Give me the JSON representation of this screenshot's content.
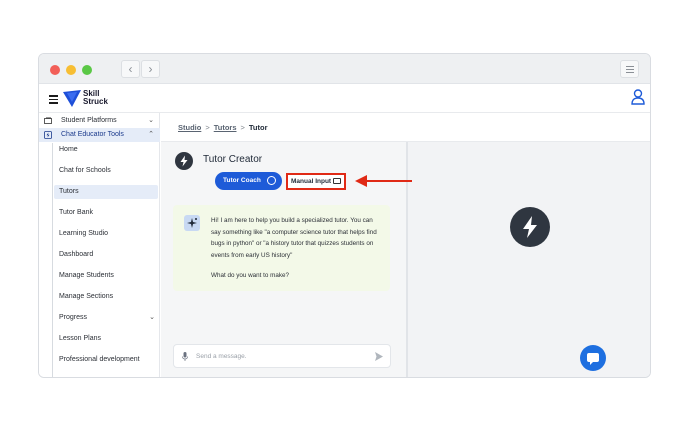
{
  "logo": {
    "line1": "Skill",
    "line2": "Struck"
  },
  "sidebar": {
    "top_items": [
      {
        "label": "Student Platforms",
        "icon": "platforms-icon"
      },
      {
        "label": "Chat Educator Tools",
        "icon": "educator-tools-icon"
      }
    ],
    "sub_items": [
      {
        "label": "Home"
      },
      {
        "label": "Chat for Schools"
      },
      {
        "label": "Tutors"
      },
      {
        "label": "Tutor Bank"
      },
      {
        "label": "Learning Studio"
      },
      {
        "label": "Dashboard"
      },
      {
        "label": "Manage Students"
      },
      {
        "label": "Manage Sections"
      },
      {
        "label": "Progress"
      },
      {
        "label": "Lesson Plans"
      },
      {
        "label": "Professional development"
      }
    ]
  },
  "breadcrumb": {
    "studio": "Studio",
    "tutors": "Tutors",
    "current": "Tutor"
  },
  "creator": {
    "title": "Tutor Creator",
    "tutor_coach_label": "Tutor Coach",
    "manual_input_label": "Manual Input",
    "message": "Hi! I am here to help you build a specialized tutor. You can say something like \"a computer science tutor that helps find bugs in python\" or \"a history tutor that quizzes students on events from early US history\"",
    "question": "What do you want to make?",
    "input_placeholder": "Send a message."
  },
  "colors": {
    "accent": "#1e5bd8",
    "annotation": "#e02a16",
    "card_bg": "#f3f9e8",
    "bolt_circle": "#2f3640"
  }
}
